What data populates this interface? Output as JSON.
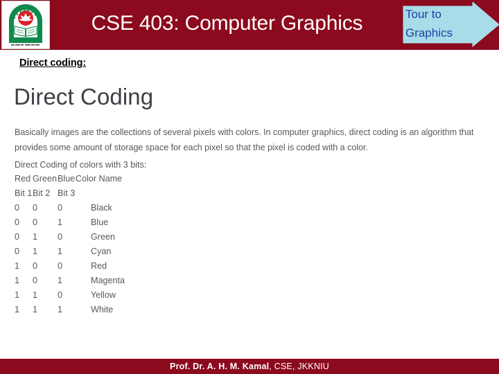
{
  "header": {
    "title": "CSE 403: Computer Graphics",
    "bar_color": "#8c0a1e",
    "title_color": "#ffffff",
    "logo": {
      "icon_name": "university-seal-logo",
      "alt": "Jatiya Kabi Kazi Nazrul Islam University seal"
    },
    "banner": {
      "line1": "Tour to",
      "line2": "Graphics",
      "fill_color": "#a8dce8",
      "text_color": "#1f3fa8",
      "shape": "right-arrow"
    }
  },
  "subtitle": {
    "text": "Direct coding:"
  },
  "document": {
    "heading": "Direct Coding",
    "paragraph": "Basically images are the collections of several pixels with colors. In computer graphics, direct coding is an algorithm that provides some amount of storage space for each pixel so that the pixel is coded with a color.",
    "caption": "Direct Coding of colors with 3 bits:",
    "table": {
      "header_row_1": [
        "Red",
        "Green",
        "Blue",
        "Color Name"
      ],
      "header_row_2": [
        "Bit 1",
        "Bit 2",
        "Bit 3",
        ""
      ],
      "rows": [
        {
          "bit1": "0",
          "bit2": "0",
          "bit3": "0",
          "name": "Black"
        },
        {
          "bit1": "0",
          "bit2": "0",
          "bit3": "1",
          "name": "Blue"
        },
        {
          "bit1": "0",
          "bit2": "1",
          "bit3": "0",
          "name": "Green"
        },
        {
          "bit1": "0",
          "bit2": "1",
          "bit3": "1",
          "name": "Cyan"
        },
        {
          "bit1": "1",
          "bit2": "0",
          "bit3": "0",
          "name": "Red"
        },
        {
          "bit1": "1",
          "bit2": "0",
          "bit3": "1",
          "name": "Magenta"
        },
        {
          "bit1": "1",
          "bit2": "1",
          "bit3": "0",
          "name": "Yellow"
        },
        {
          "bit1": "1",
          "bit2": "1",
          "bit3": "1",
          "name": "White"
        }
      ]
    }
  },
  "footer": {
    "bold_text": "Prof. Dr. A. H. M. Kamal",
    "rest_text": ", CSE, JKKNIU",
    "bar_color": "#8c0a1e",
    "text_color": "#ffffff"
  }
}
